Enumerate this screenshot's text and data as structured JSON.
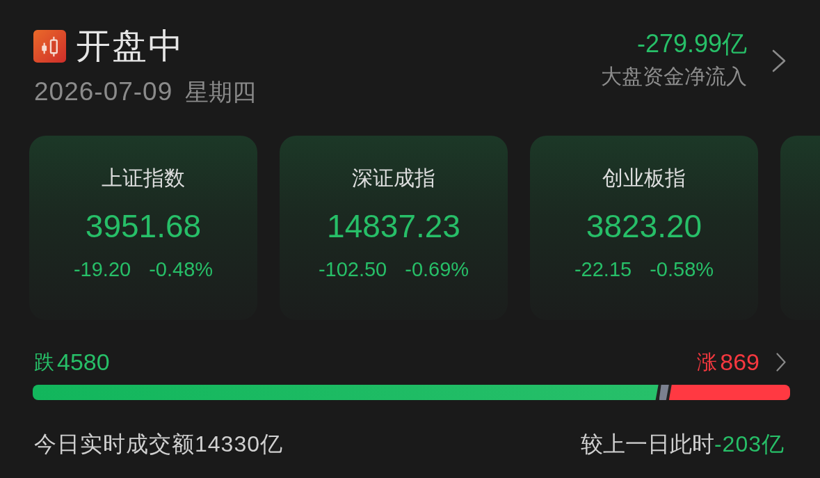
{
  "header": {
    "title": "开盘中",
    "date": "2026-07-09",
    "weekday": "星期四"
  },
  "net_flow": {
    "value": "-279.99亿",
    "negative": true,
    "label": "大盘资金净流入"
  },
  "indices": [
    {
      "kind": "index",
      "name": "上证指数",
      "value": "3951.68",
      "change": "-19.20",
      "change_percent": "-0.48%",
      "negative": true
    },
    {
      "kind": "index",
      "name": "深证成指",
      "value": "14837.23",
      "change": "-102.50",
      "change_percent": "-0.69%",
      "negative": true
    },
    {
      "kind": "index",
      "name": "创业板指",
      "value": "3823.20",
      "change": "-22.15",
      "change_percent": "-0.58%",
      "negative": true
    },
    {
      "kind": "partial"
    }
  ],
  "breadth": {
    "down": {
      "label": "跌",
      "count": "4580",
      "negative": true
    },
    "up": {
      "label": "涨",
      "count": "869",
      "negative": false
    },
    "segments": [
      {
        "kind": "down",
        "level": 0.827
      },
      {
        "kind": "flat",
        "level": 0.013
      },
      {
        "kind": "up",
        "level": 0.16
      }
    ]
  },
  "turnover": {
    "label": "今日实时成交额",
    "value": "14330亿",
    "compare_label": "较上一日此时",
    "compare_value": "-203亿",
    "compare_negative": true
  }
}
